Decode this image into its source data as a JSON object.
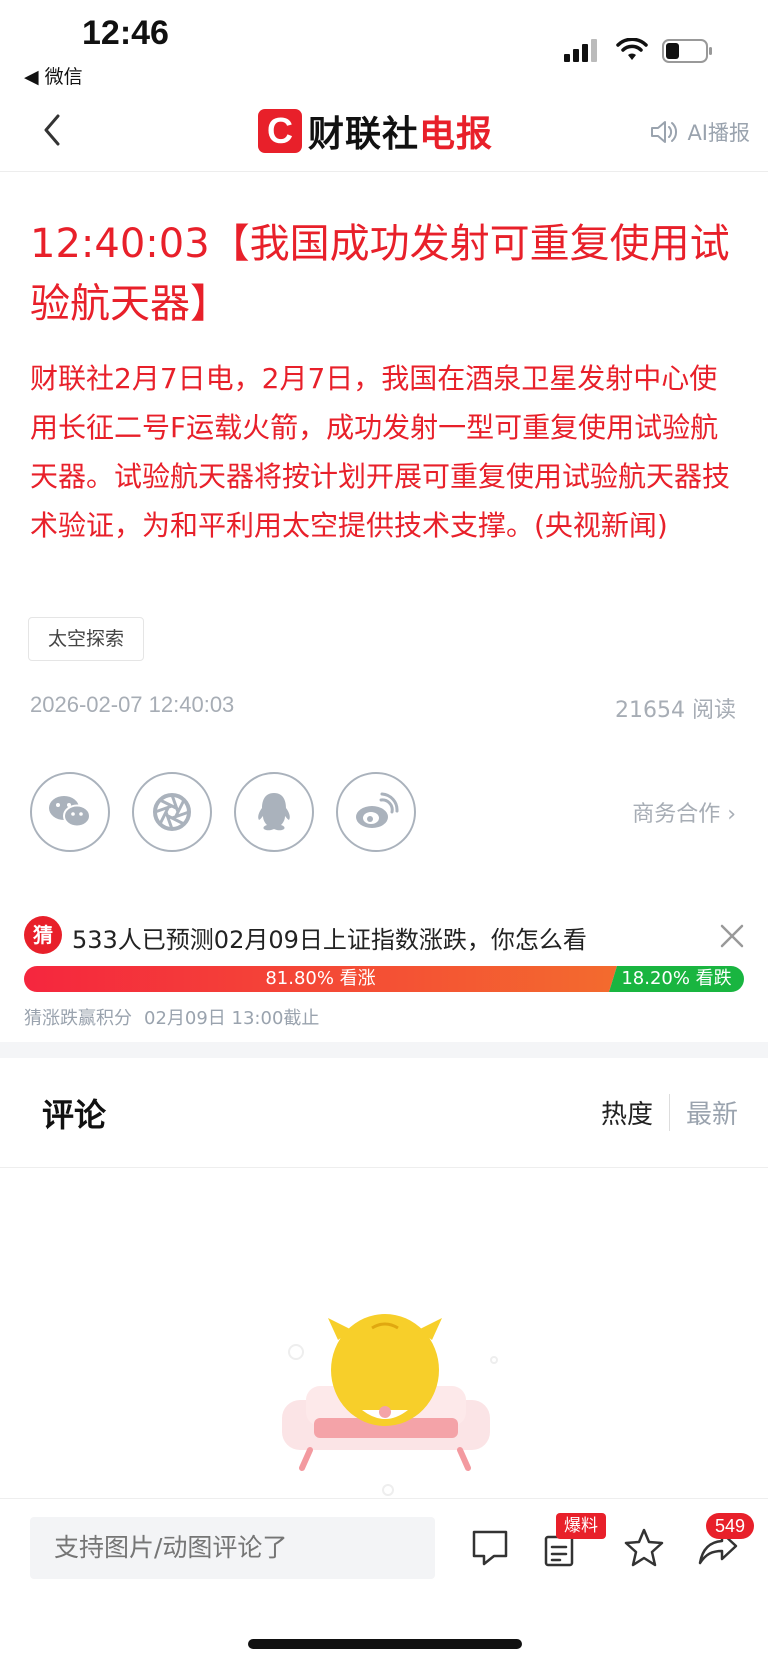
{
  "status_bar": {
    "time": "12:46",
    "back_app": "◀ 微信"
  },
  "nav": {
    "logo_brand": "财联社",
    "logo_accent": "电报",
    "logo_mark": "C",
    "ai_play_label": "AI播报"
  },
  "article": {
    "headline": "12:40:03【我国成功发射可重复使用试验航天器】",
    "body": "财联社2月7日电，2月7日，我国在酒泉卫星发射中心使用长征二号F运载火箭，成功发射一型可重复使用试验航天器。试验航天器将按计划开展可重复使用试验航天器技术验证，为和平利用太空提供技术支撑。(央视新闻)",
    "tag": "太空探索",
    "datetime": "2026-02-07 12:40:03",
    "reads": "21654 阅读",
    "business_link": "商务合作 ›"
  },
  "share": {
    "icons": [
      "wechat-icon",
      "moments-icon",
      "qq-icon",
      "weibo-icon"
    ]
  },
  "prediction": {
    "badge": "猜",
    "question": "533人已预测02月09日上证指数涨跌，你怎么看",
    "up_label": "81.80% 看涨",
    "down_label": "18.20% 看跌",
    "up_fraction": 0.818,
    "footer_left": "猜涨跌赢积分",
    "footer_right": "02月09日 13:00截止"
  },
  "comments": {
    "title": "评论",
    "sort_hot": "热度",
    "sort_new": "最新"
  },
  "bottom_bar": {
    "input_placeholder": "支持图片/动图评论了",
    "baoliao": "爆料",
    "share_count": "549"
  },
  "colors": {
    "accent": "#e8202a",
    "up": "#f5263e",
    "down": "#19b540",
    "muted": "#a7adb5"
  }
}
